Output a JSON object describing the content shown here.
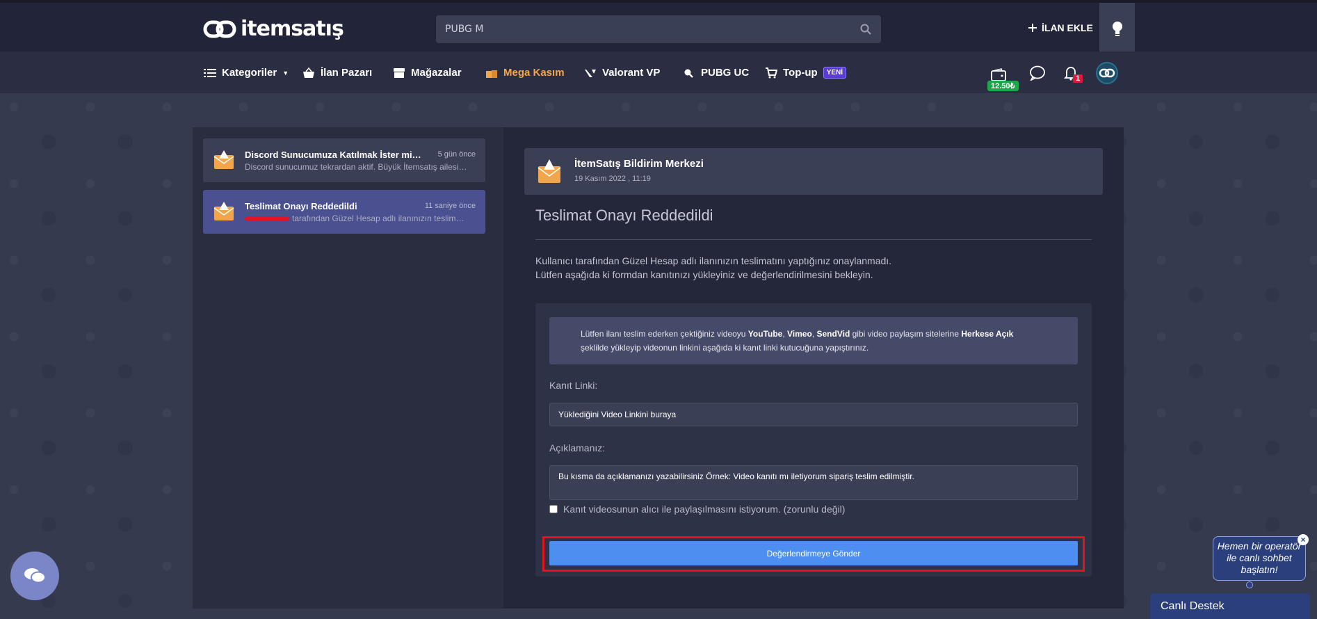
{
  "header": {
    "logo_text": "itemsatış",
    "search_value": "PUBG M",
    "add_listing_label": "İLAN EKLE"
  },
  "nav": {
    "items": [
      {
        "label": "Kategoriler"
      },
      {
        "label": "İlan Pazarı"
      },
      {
        "label": "Mağazalar"
      },
      {
        "label": "Mega Kasım"
      },
      {
        "label": "Valorant VP"
      },
      {
        "label": "PUBG UC"
      },
      {
        "label": "Top-up"
      }
    ],
    "new_badge": "YENİ",
    "wallet_amount": "12.50₺",
    "notification_count": "1"
  },
  "notifications": [
    {
      "title": "Discord Sunucumuza Katılmak İster misiniz?",
      "time": "5 gün önce",
      "desc": "Discord sunucumuz tekrardan aktif. Büyük İtemsatış ailesine katılın."
    },
    {
      "title": "Teslimat Onayı Reddedildi",
      "time": "11 saniye önce",
      "desc": "tarafından Güzel Hesap adlı ilanınızın teslimatını yaptığınız onaylanmadı."
    }
  ],
  "detail": {
    "sender": "İtemSatış Bildirim Merkezi",
    "date": "19 Kasım 2022 , 11:19",
    "subject": "Teslimat Onayı Reddedildi",
    "body_line1": "Kullanıcı tarafından Güzel Hesap adlı ilanınızın teslimatını yaptığınız onaylanmadı.",
    "body_line2": "Lütfen aşağıda ki formdan kanıtınızı yükleyiniz ve değerlendirilmesini bekleyin.",
    "info_prefix": "Lütfen ilanı teslim ederken çektiğiniz videoyu ",
    "info_youtube": "YouTube",
    "info_sep1": ", ",
    "info_vimeo": "Vimeo",
    "info_sep2": ", ",
    "info_sendvid": "SendVid",
    "info_mid": " gibi video paylaşım sitelerine ",
    "info_public": "Herkese Açık",
    "info_suffix": "şeklilde yükleyip videonun linkini aşağıda ki kanıt linki kutucuğuna yapıştırınız.",
    "proof_label": "Kanıt Linki:",
    "proof_placeholder": "Yüklediğini Video Linkini buraya",
    "desc_label": "Açıklamanız:",
    "desc_placeholder": "Bu kısma da açıklamanızı yazabilirsiniz Örnek: Video kanıtı mı iletiyorum sipariş teslim edilmiştir.",
    "checkbox_label": "Kanıt videosunun alıcı ile paylaşılmasını istiyorum. (zorunlu değil)",
    "submit_label": "Değerlendirmeye Gönder"
  },
  "support": {
    "tip_text": "Hemen bir operatör ile canlı sohbet başlatın!",
    "bar_label": "Canlı Destek"
  },
  "colors": {
    "accent_orange": "#f2a54a",
    "submit_blue": "#4d8ff0",
    "highlight_red": "#e2141e",
    "wallet_green": "#1ca94a"
  }
}
